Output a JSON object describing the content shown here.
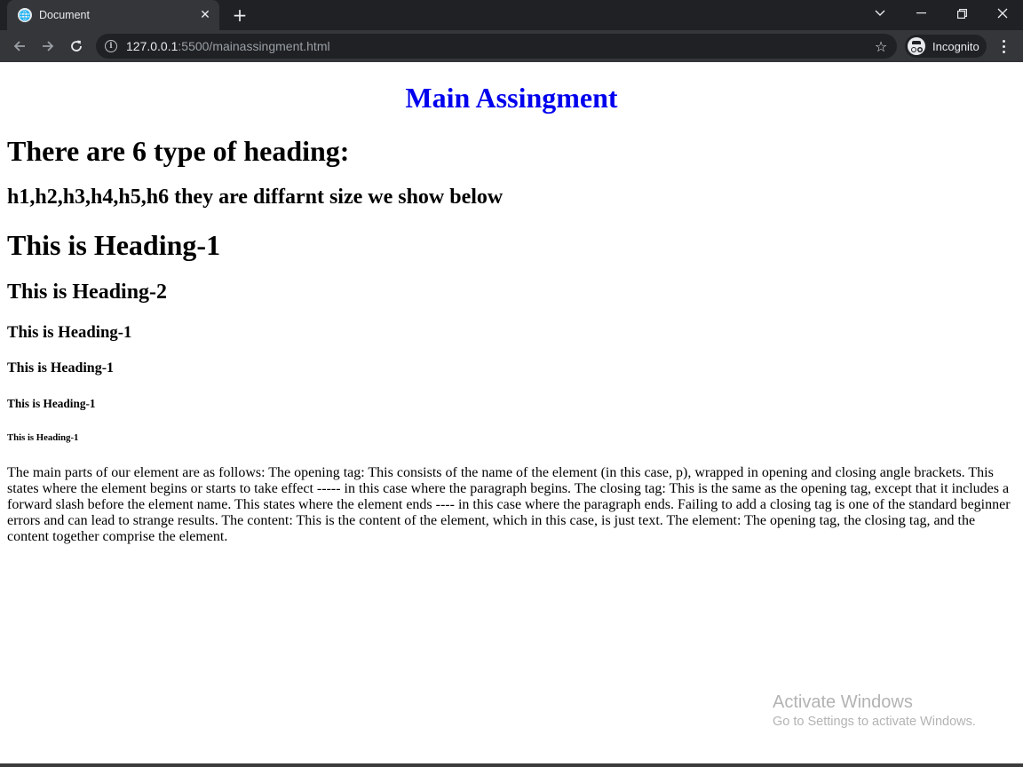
{
  "browser": {
    "tab_title": "Document",
    "tab_close_glyph": "✕",
    "new_tab_glyph": "+",
    "url_host": "127.0.0.1",
    "url_rest": ":5500/mainassingment.html",
    "incognito_label": "Incognito",
    "icons": [
      "globe-icon",
      "close-icon",
      "plus-icon",
      "chevron-down-icon",
      "minimize-icon",
      "restore-icon",
      "window-close-icon",
      "back-icon",
      "forward-icon",
      "reload-icon",
      "info-icon",
      "star-icon",
      "incognito-icon",
      "menu-icon"
    ]
  },
  "page": {
    "title": "Main Assingment",
    "intro_heading": "There are 6 type of heading:",
    "sub_heading": "h1,h2,h3,h4,h5,h6 they are diffarnt size we show below",
    "headings": [
      "This is Heading-1",
      "This is Heading-2",
      "This is Heading-1",
      "This is Heading-1",
      "This is Heading-1",
      "This is Heading-1"
    ],
    "paragraph": "The main parts of our element are as follows: The opening tag: This consists of the name of the element (in this case, p), wrapped in opening and closing angle brackets. This states where the element begins or starts to take effect ----- in this case where the paragraph begins. The closing tag: This is the same as the opening tag, except that it includes a forward slash before the element name. This states where the element ends ---- in this case where the paragraph ends. Failing to add a closing tag is one of the standard beginner errors and can lead to strange results. The content: This is the content of the element, which in this case, is just text. The element: The opening tag, the closing tag, and the content together comprise the element."
  },
  "watermark": {
    "title": "Activate Windows",
    "subtitle": "Go to Settings to activate Windows."
  },
  "colors": {
    "title": "#0000ee",
    "chrome_dark": "#202124",
    "chrome_tab": "#35363a"
  }
}
